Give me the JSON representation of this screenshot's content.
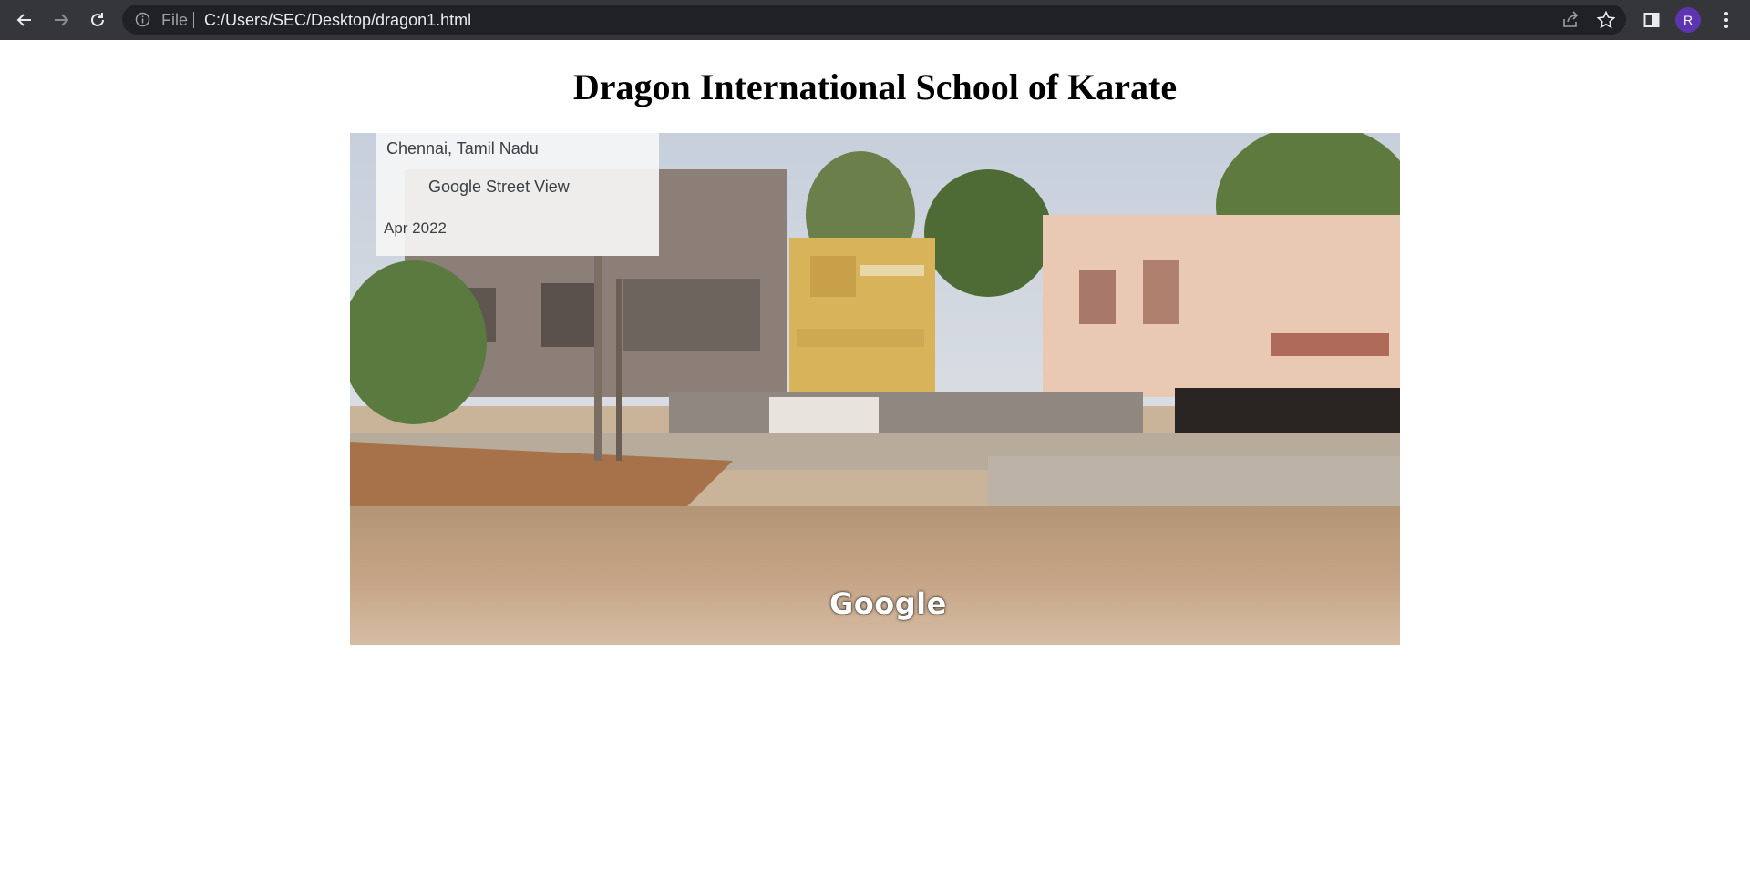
{
  "browser": {
    "file_label": "File",
    "url": "C:/Users/SEC/Desktop/dragon1.html",
    "profile_initial": "R",
    "profile_color": "#5e35b1",
    "icons": [
      "back-arrow-icon",
      "forward-arrow-icon",
      "reload-icon",
      "info-icon",
      "share-icon",
      "star-icon",
      "side-panel-icon",
      "more-vert-icon"
    ]
  },
  "page": {
    "title": "Dragon International School of Karate"
  },
  "street_view": {
    "location": "Chennai, Tamil Nadu",
    "source": "Google Street View",
    "date": "Apr 2022",
    "logo": "Google"
  }
}
